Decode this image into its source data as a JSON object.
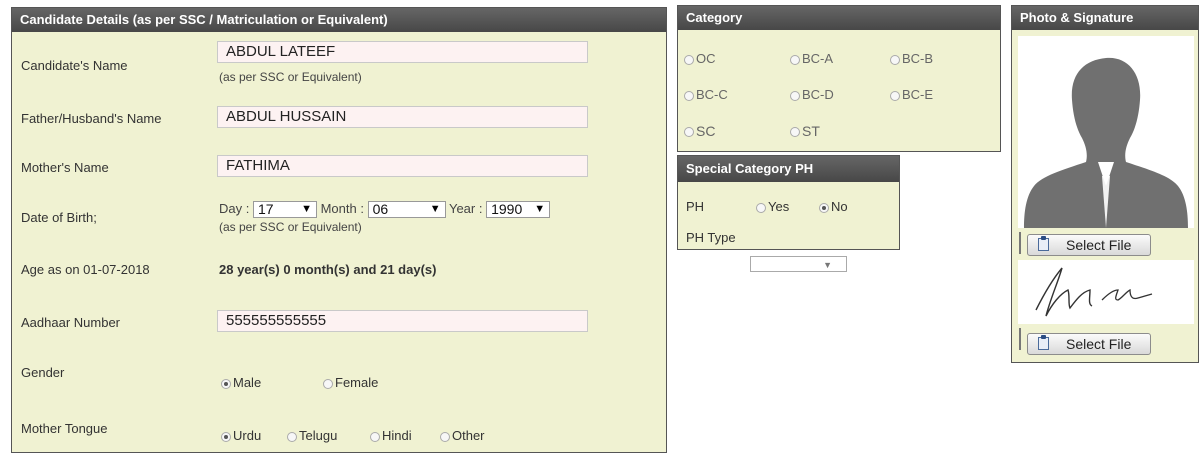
{
  "candidate": {
    "header": "Candidate Details (as per SSC / Matriculation or Equivalent)",
    "name_label": "Candidate's Name",
    "name_value": "ABDUL LATEEF",
    "name_hint": "(as per SSC or Equivalent)",
    "father_label": "Father/Husband's Name",
    "father_value": "ABDUL HUSSAIN",
    "mother_label": "Mother's Name",
    "mother_value": "FATHIMA",
    "dob_label": "Date of Birth;",
    "day_label": "Day :",
    "day_value": "17",
    "month_label": "Month :",
    "month_value": "06",
    "year_label": "Year :",
    "year_value": "1990",
    "dob_hint": "(as per SSC or Equivalent)",
    "age_label": "Age as on 01-07-2018",
    "age_value": "28 year(s) 0 month(s) and 21 day(s)",
    "aadhaar_label": "Aadhaar Number",
    "aadhaar_value": "555555555555",
    "gender_label": "Gender",
    "gender_male": "Male",
    "gender_female": "Female",
    "gender_selected": "Male",
    "tongue_label": "Mother Tongue",
    "tongue_urdu": "Urdu",
    "tongue_telugu": "Telugu",
    "tongue_hindi": "Hindi",
    "tongue_other": "Other",
    "tongue_selected": "Urdu"
  },
  "category": {
    "header": "Category",
    "options": [
      "OC",
      "BC-A",
      "BC-B",
      "BC-C",
      "BC-D",
      "BC-E",
      "SC",
      "ST"
    ]
  },
  "special": {
    "header": "Special Category PH",
    "ph_label": "PH",
    "yes": "Yes",
    "no": "No",
    "selected": "No",
    "ph_type_label": "PH Type",
    "ph_type_value": ""
  },
  "photo": {
    "header": "Photo & Signature",
    "select_photo": "Select File",
    "select_signature": "Select File"
  },
  "colors": {
    "panel_bg": "#f0f2d2",
    "header_bg": "#555555",
    "input_bg": "#fdf2f2"
  }
}
